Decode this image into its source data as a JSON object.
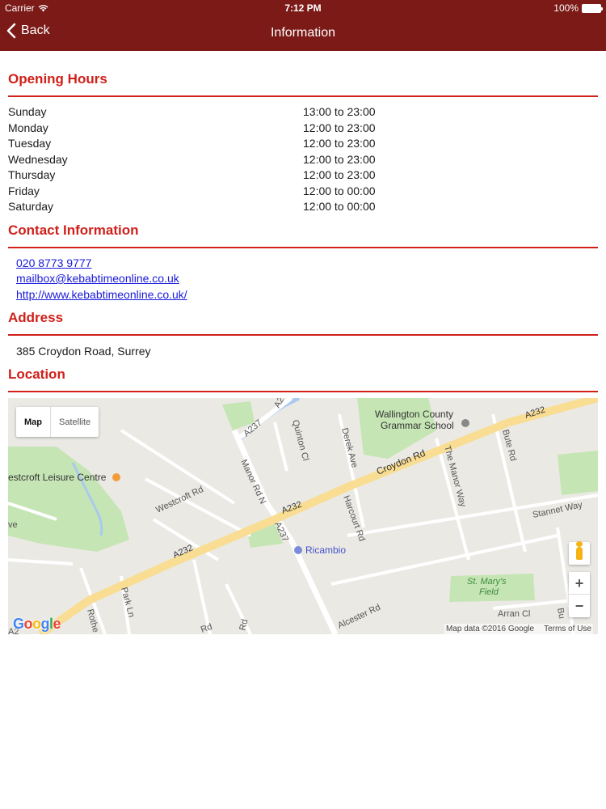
{
  "status_bar": {
    "carrier": "Carrier",
    "time": "7:12 PM",
    "battery": "100%"
  },
  "nav": {
    "back_label": "Back",
    "title": "Information"
  },
  "opening_hours": {
    "title": "Opening Hours",
    "rows": [
      {
        "day": "Sunday",
        "hours": "13:00 to 23:00"
      },
      {
        "day": "Monday",
        "hours": "12:00 to 23:00"
      },
      {
        "day": "Tuesday",
        "hours": "12:00 to 23:00"
      },
      {
        "day": "Wednesday",
        "hours": "12:00 to 23:00"
      },
      {
        "day": "Thursday",
        "hours": "12:00 to 23:00"
      },
      {
        "day": "Friday",
        "hours": "12:00 to 00:00"
      },
      {
        "day": "Saturday",
        "hours": "12:00 to 00:00"
      }
    ]
  },
  "contact": {
    "title": "Contact Information",
    "phone": "020 8773 9777",
    "email": "mailbox@kebabtimeonline.co.uk",
    "website": "http://www.kebabtimeonline.co.uk/"
  },
  "address": {
    "title": "Address",
    "text": "385 Croydon Road, Surrey"
  },
  "location": {
    "title": "Location",
    "map": {
      "map_label": "Map",
      "satellite_label": "Satellite",
      "zoom_in": "+",
      "zoom_out": "−",
      "attribution": "Map data ©2016 Google",
      "terms": "Terms of Use",
      "logo": "Google",
      "labels": {
        "school": "Wallington County",
        "school2": "Grammar School",
        "leisure": "estcroft Leisure Centre",
        "westcroft": "Westcroft Rd",
        "manor": "Manor Rd N",
        "a237a": "A237",
        "a237b": "A237",
        "a232a": "A232",
        "a232b": "A232",
        "a232c": "A232",
        "croydon": "Croydon Rd",
        "quinton": "Quinton Cl",
        "derek": "Derek Ave",
        "harcourt": "Harcourt Rd",
        "manorway": "The Manor Way",
        "bute": "Bute Rd",
        "stannet": "Stannet Way",
        "ricambio": "Ricambio",
        "stmarys": "St. Mary's",
        "field": "Field",
        "alcester": "Alcester Rd",
        "arran": "Arran Cl",
        "park": "Park Ln",
        "rother": "Rothe",
        "rd1": "Rd",
        "rd2": "Rd",
        "ve": "ve",
        "a22": "A2",
        "a237c": "A2",
        "b": "Bu"
      }
    }
  }
}
